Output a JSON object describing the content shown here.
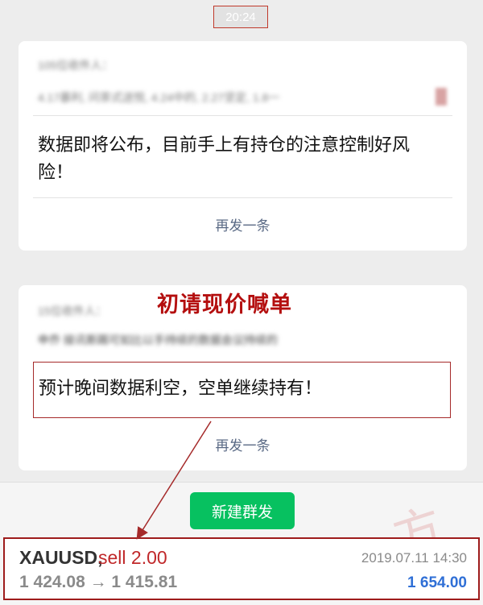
{
  "time": "20:24",
  "card1": {
    "recipients_line": "105位收件人：",
    "names_line": "4.17暴利, 问茶式送悦, 4.24中的, 2.27坚定, 1.8一",
    "message": "数据即将公布，目前手上有持仓的注意控制好风险！",
    "resend": "再发一条"
  },
  "headline": "初请现价喊单",
  "card2": {
    "recipients_line": "15位收件人：",
    "names_line": "申乔 接讯斯踢可如比以手持续的数据会议持续的",
    "message": "预计晚间数据利空，空单继续持有！",
    "resend": "再发一条"
  },
  "new_group_button": "新建群发",
  "trade": {
    "symbol": "XAUUSD,",
    "side": "sell 2.00",
    "prices": "1 424.08 → 1 415.81",
    "datetime": "2019.07.11 14:30",
    "profit": "1 654.00"
  },
  "colors": {
    "annotation_red": "#a52a2a",
    "headline_red": "#b40f0f",
    "button_green": "#07c160",
    "profit_blue": "#2f6fd6"
  }
}
